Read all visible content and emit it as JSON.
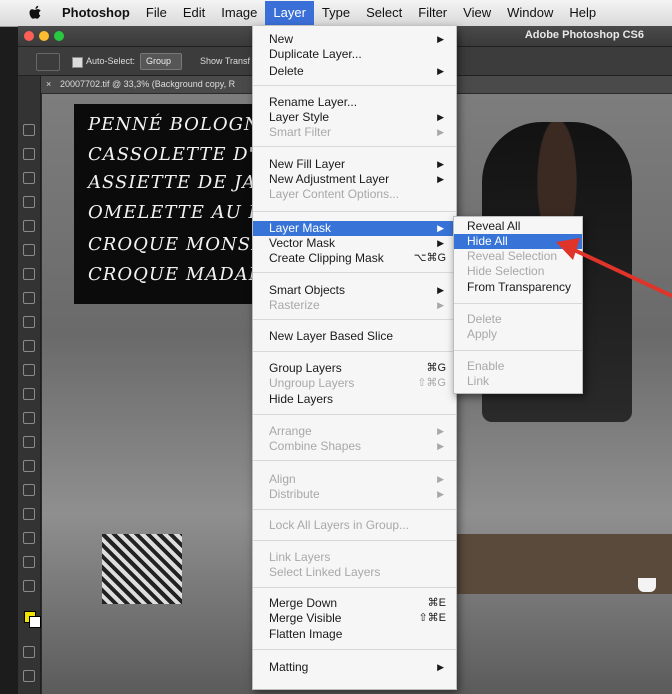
{
  "menubar": {
    "items": [
      "Photoshop",
      "File",
      "Edit",
      "Image",
      "Layer",
      "Type",
      "Select",
      "Filter",
      "View",
      "Window",
      "Help"
    ],
    "active_item": "Layer",
    "app_version": "Adobe Photoshop CS6"
  },
  "options_bar": {
    "auto_select_label": "Auto-Select:",
    "group_value": "Group",
    "show_transform_label": "Show Transf"
  },
  "document_tab": {
    "title": "20007702.tif @ 33,3% (Background copy, R"
  },
  "chalkboard": {
    "lines": [
      "PENNÉ BOLOGNA",
      "CASSOLETTE D'E",
      "ASSIETTE DE JAM",
      "OMELETTE AU FR",
      "CROQUE MONSIEU",
      "CROQUE MADAM"
    ]
  },
  "layer_menu": {
    "items": [
      {
        "label": "New",
        "submenu": true,
        "enabled": true
      },
      {
        "label": "Duplicate Layer...",
        "enabled": true
      },
      {
        "label": "Delete",
        "submenu": true,
        "enabled": true
      },
      {
        "label": "Rename Layer...",
        "enabled": true
      },
      {
        "label": "Layer Style",
        "submenu": true,
        "enabled": true
      },
      {
        "label": "Smart Filter",
        "submenu": true,
        "enabled": false
      },
      {
        "label": "New Fill Layer",
        "submenu": true,
        "enabled": true
      },
      {
        "label": "New Adjustment Layer",
        "submenu": true,
        "enabled": true
      },
      {
        "label": "Layer Content Options...",
        "enabled": false
      },
      {
        "label": "Layer Mask",
        "submenu": true,
        "enabled": true,
        "highlighted": true
      },
      {
        "label": "Vector Mask",
        "submenu": true,
        "enabled": true
      },
      {
        "label": "Create Clipping Mask",
        "shortcut": "⌥⌘G",
        "enabled": true
      },
      {
        "label": "Smart Objects",
        "submenu": true,
        "enabled": true
      },
      {
        "label": "Rasterize",
        "submenu": true,
        "enabled": false
      },
      {
        "label": "New Layer Based Slice",
        "enabled": true
      },
      {
        "label": "Group Layers",
        "shortcut": "⌘G",
        "enabled": true
      },
      {
        "label": "Ungroup Layers",
        "shortcut": "⇧⌘G",
        "enabled": false
      },
      {
        "label": "Hide Layers",
        "enabled": true
      },
      {
        "label": "Arrange",
        "submenu": true,
        "enabled": false
      },
      {
        "label": "Combine Shapes",
        "submenu": true,
        "enabled": false
      },
      {
        "label": "Align",
        "submenu": true,
        "enabled": false
      },
      {
        "label": "Distribute",
        "submenu": true,
        "enabled": false
      },
      {
        "label": "Lock All Layers in Group...",
        "enabled": false
      },
      {
        "label": "Link Layers",
        "enabled": false
      },
      {
        "label": "Select Linked Layers",
        "enabled": false
      },
      {
        "label": "Merge Down",
        "shortcut": "⌘E",
        "enabled": true
      },
      {
        "label": "Merge Visible",
        "shortcut": "⇧⌘E",
        "enabled": true
      },
      {
        "label": "Flatten Image",
        "enabled": true
      },
      {
        "label": "Matting",
        "submenu": true,
        "enabled": true
      }
    ]
  },
  "layer_mask_submenu": {
    "items": [
      {
        "label": "Reveal All",
        "enabled": true
      },
      {
        "label": "Hide All",
        "enabled": true,
        "highlighted": true
      },
      {
        "label": "Reveal Selection",
        "enabled": false
      },
      {
        "label": "Hide Selection",
        "enabled": false
      },
      {
        "label": "From Transparency",
        "enabled": true
      },
      {
        "label": "Delete",
        "enabled": false
      },
      {
        "label": "Apply",
        "enabled": false
      },
      {
        "label": "Enable",
        "enabled": false
      },
      {
        "label": "Link",
        "enabled": false
      }
    ]
  },
  "colors": {
    "menu_highlight": "#3874d8",
    "foreground_swatch": "#f1e300",
    "callout_arrow": "#e0332a"
  }
}
